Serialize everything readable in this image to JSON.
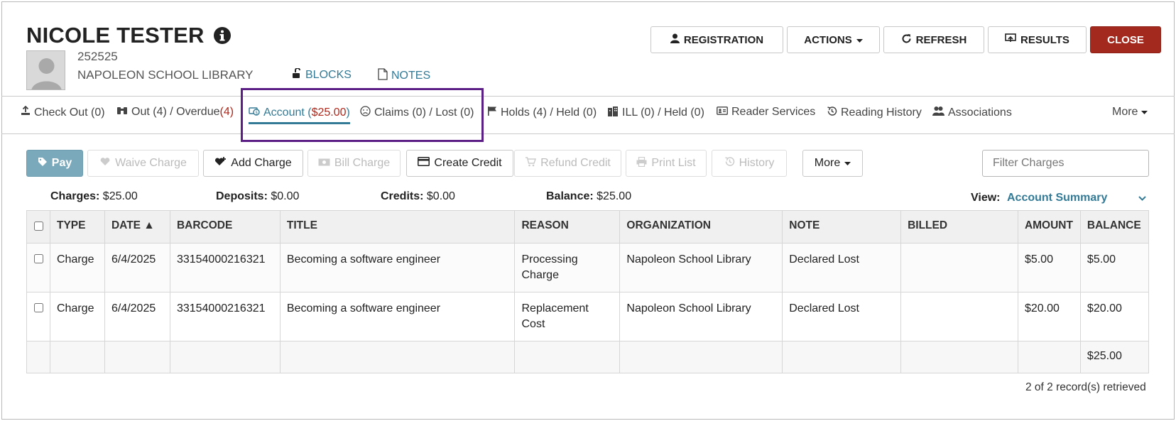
{
  "patron": {
    "name": "NICOLE TESTER",
    "id": "252525",
    "library": "NAPOLEON SCHOOL LIBRARY",
    "blocks_link": "BLOCKS",
    "notes_link": "NOTES"
  },
  "header_buttons": {
    "registration": "REGISTRATION",
    "actions": "ACTIONS",
    "refresh": "REFRESH",
    "results": "RESULTS",
    "close": "CLOSE"
  },
  "tabs": {
    "checkout": "Check Out (0)",
    "out": "Out (4) / Overdue ",
    "overdue_count": "(4)",
    "account": "Account (",
    "account_amount": "$25.00",
    "account_close": ")",
    "claims": "Claims (0) / Lost (0)",
    "holds": "Holds (4) / Held (0)",
    "ill": "ILL (0) / Held (0)",
    "reader_services": "Reader Services",
    "reading_history": "Reading History",
    "associations": "Associations",
    "more": "More"
  },
  "toolbar": {
    "pay": "Pay",
    "waive": "Waive Charge",
    "add": "Add Charge",
    "bill": "Bill Charge",
    "create_credit": "Create Credit",
    "refund": "Refund Credit",
    "print": "Print List",
    "history": "History",
    "more": "More",
    "filter_placeholder": "Filter Charges"
  },
  "summary": {
    "charges_label": "Charges:",
    "charges_value": " $25.00",
    "deposits_label": "Deposits:",
    "deposits_value": " $0.00",
    "credits_label": "Credits:",
    "credits_value": " $0.00",
    "balance_label": "Balance:",
    "balance_value": " $25.00",
    "view_label": "View:",
    "view_value": "Account Summary"
  },
  "table": {
    "headers": [
      "TYPE",
      "DATE ▲",
      "BARCODE",
      "TITLE",
      "REASON",
      "ORGANIZATION",
      "NOTE",
      "BILLED",
      "AMOUNT",
      "BALANCE"
    ],
    "rows": [
      {
        "type": "Charge",
        "date": "6/4/2025",
        "barcode": "33154000216321",
        "title": "Becoming a software engineer",
        "reason": "Processing Charge",
        "organization": "Napoleon School Library",
        "note": "Declared Lost",
        "billed": "",
        "amount": "$5.00",
        "balance": "$5.00"
      },
      {
        "type": "Charge",
        "date": "6/4/2025",
        "barcode": "33154000216321",
        "title": "Becoming a software engineer",
        "reason": "Replacement Cost",
        "organization": "Napoleon School Library",
        "note": "Declared Lost",
        "billed": "",
        "amount": "$20.00",
        "balance": "$20.00"
      }
    ],
    "total_balance": "$25.00"
  },
  "records_text": "2 of 2 record(s) retrieved",
  "colors": {
    "accent": "#337a96",
    "close_button": "#a3281d",
    "overdue_red": "#b0281c",
    "highlight_box": "#5c1f86",
    "pay_button": "#7aa9bc"
  }
}
